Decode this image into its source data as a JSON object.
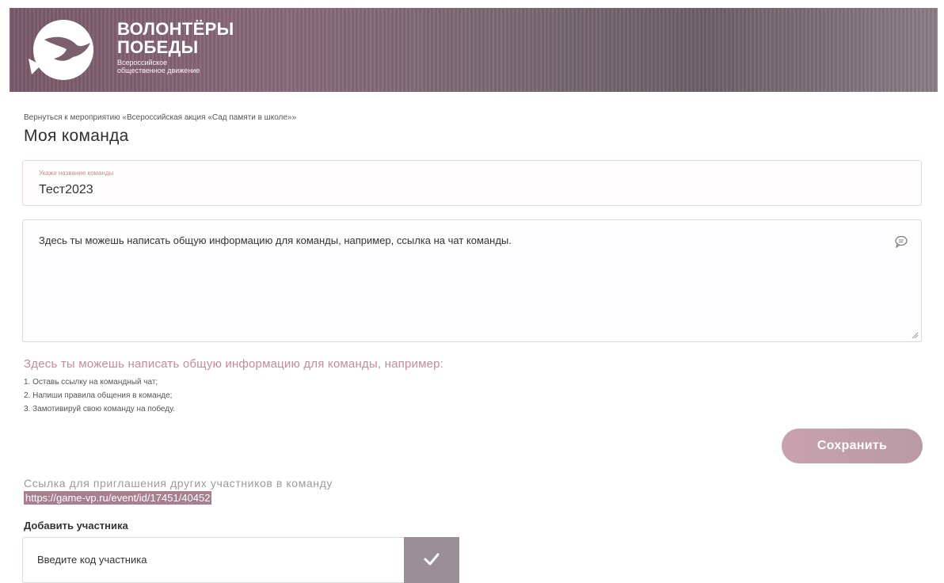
{
  "header": {
    "logo_line1": "ВОЛОНТЁРЫ",
    "logo_line2": "ПОБЕДЫ",
    "logo_sub1": "Всероссийское",
    "logo_sub2": "общественное движение"
  },
  "back_link": "Вернуться к мероприятию «Всероссийская акция «Сад памяти в школе»»",
  "page_title": "Моя команда",
  "team_name": {
    "label": "Укажи название команды",
    "value": "Тест2023"
  },
  "info": {
    "text": "Здесь ты можешь написать общую информацию для команды, например, ссылка на чат команды."
  },
  "hint": {
    "title": "Здесь ты можешь написать общую информацию для команды, например:",
    "items": [
      "1. Оставь ссылку на командный чат;",
      "2. Напиши правила общения в команде;",
      "3. Замотивируй свою команду на победу."
    ]
  },
  "save_label": "Сохранить",
  "invite": {
    "title": "Ссылка для приглашения других участников в команду",
    "link": "https://game-vp.ru/event/id/17451/40452"
  },
  "add_member": {
    "title": "Добавить участника",
    "placeholder": "Введите код участника"
  },
  "colors": {
    "accent": "#c98a9a",
    "save_button": "#c8a2ae",
    "confirm_button": "#9a8f96"
  }
}
